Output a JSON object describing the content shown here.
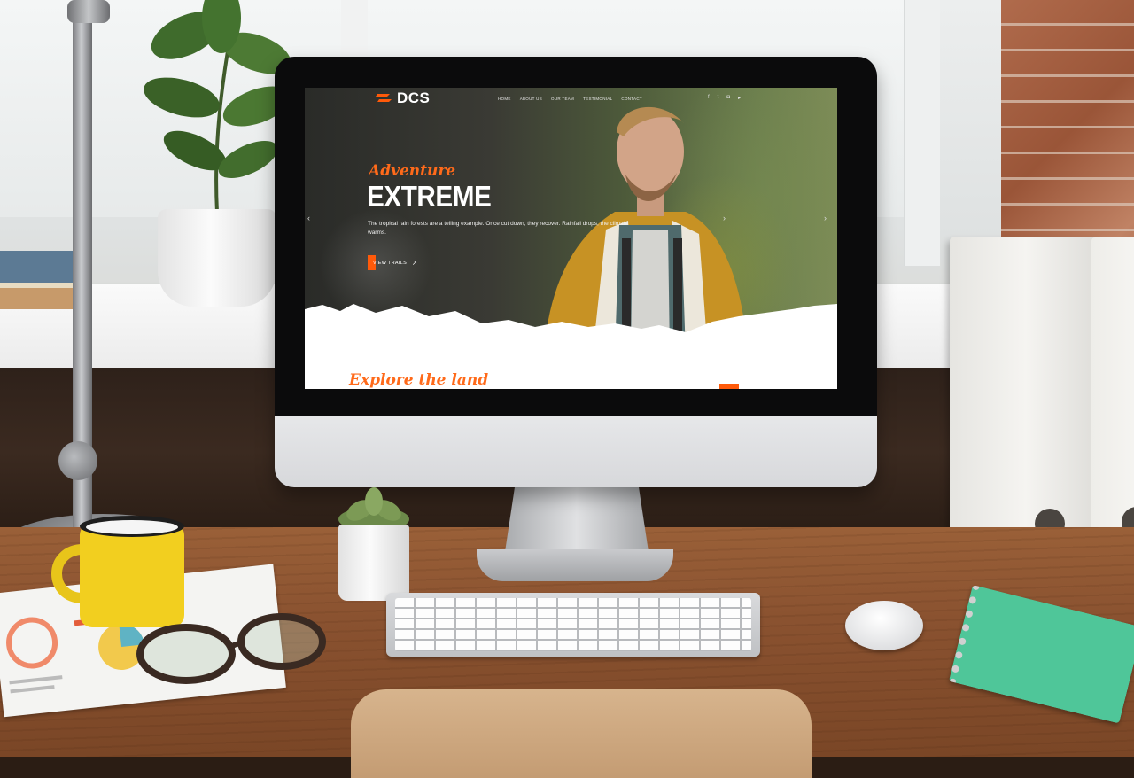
{
  "screen": {
    "logo": "DCS",
    "nav": [
      "HOME",
      "ABOUT US",
      "OUR TEAM",
      "TESTIMONIAL",
      "CONTACT"
    ],
    "social_icons": [
      "facebook-icon",
      "twitter-icon",
      "instagram-icon",
      "youtube-icon",
      "vimeo-icon"
    ],
    "hero": {
      "kicker": "Adventure",
      "headline": "EXTREME",
      "description": "The tropical rain forests are a telling example. Once cut down, they recover. Rainfall drops, the climate warms.",
      "cta_label": "VIEW TRAILS"
    },
    "section_title": "Explore the land"
  },
  "colors": {
    "accent": "#ff5a0a",
    "hero_text": "#ffffff"
  }
}
